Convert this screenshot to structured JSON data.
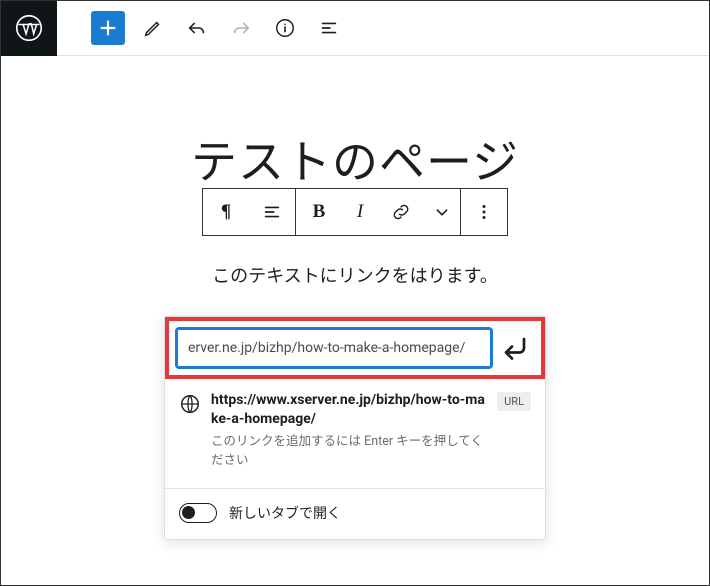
{
  "toolbar": {
    "wp_logo": "wordpress",
    "add": "add",
    "edit": "edit",
    "undo": "undo",
    "redo": "redo",
    "info": "info",
    "outline": "outline"
  },
  "page": {
    "title": "テストのページ",
    "paragraph": "このテキストにリンクをはります。"
  },
  "block_toolbar": {
    "paragraph_icon": "¶",
    "align": "align",
    "bold": "B",
    "italic": "I",
    "link": "link",
    "chevron": "chevron",
    "more": "more"
  },
  "link_popover": {
    "input_value": "erver.ne.jp/bizhp/how-to-make-a-homepage/",
    "submit": "submit",
    "suggestion_url": "https://www.xserver.ne.jp/bizhp/how-to-make-a-homepage/",
    "suggestion_hint": "このリンクを追加するには Enter キーを押してください",
    "badge": "URL",
    "new_tab_label": "新しいタブで開く"
  }
}
